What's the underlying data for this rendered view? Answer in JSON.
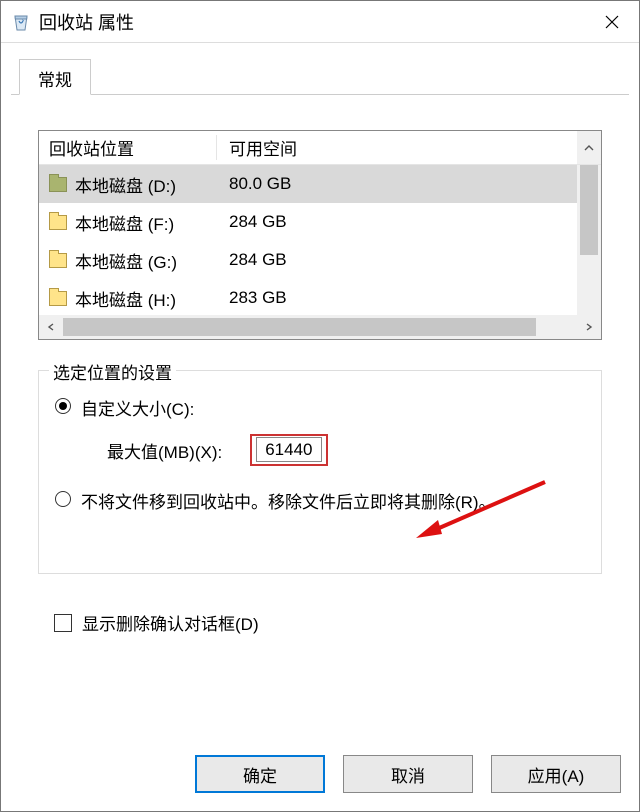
{
  "title": "回收站 属性",
  "tab": {
    "general": "常规"
  },
  "list": {
    "headers": {
      "location": "回收站位置",
      "space": "可用空间"
    },
    "rows": [
      {
        "name": "本地磁盘 (D:)",
        "space": "80.0 GB",
        "selected": true,
        "iconColor": "green"
      },
      {
        "name": "本地磁盘 (F:)",
        "space": "284 GB",
        "selected": false,
        "iconColor": "yellow"
      },
      {
        "name": "本地磁盘 (G:)",
        "space": "284 GB",
        "selected": false,
        "iconColor": "yellow"
      },
      {
        "name": "本地磁盘 (H:)",
        "space": "283 GB",
        "selected": false,
        "iconColor": "yellow"
      }
    ]
  },
  "settings": {
    "group_title": "选定位置的设置",
    "custom_size_label": "自定义大小(C):",
    "max_label": "最大值(MB)(X):",
    "max_value": "61440",
    "no_recycle_label": "不将文件移到回收站中。移除文件后立即将其删除(R)。",
    "selected_option": "custom"
  },
  "confirm": {
    "label": "显示删除确认对话框(D)",
    "checked": false
  },
  "buttons": {
    "ok": "确定",
    "cancel": "取消",
    "apply": "应用(A)"
  }
}
